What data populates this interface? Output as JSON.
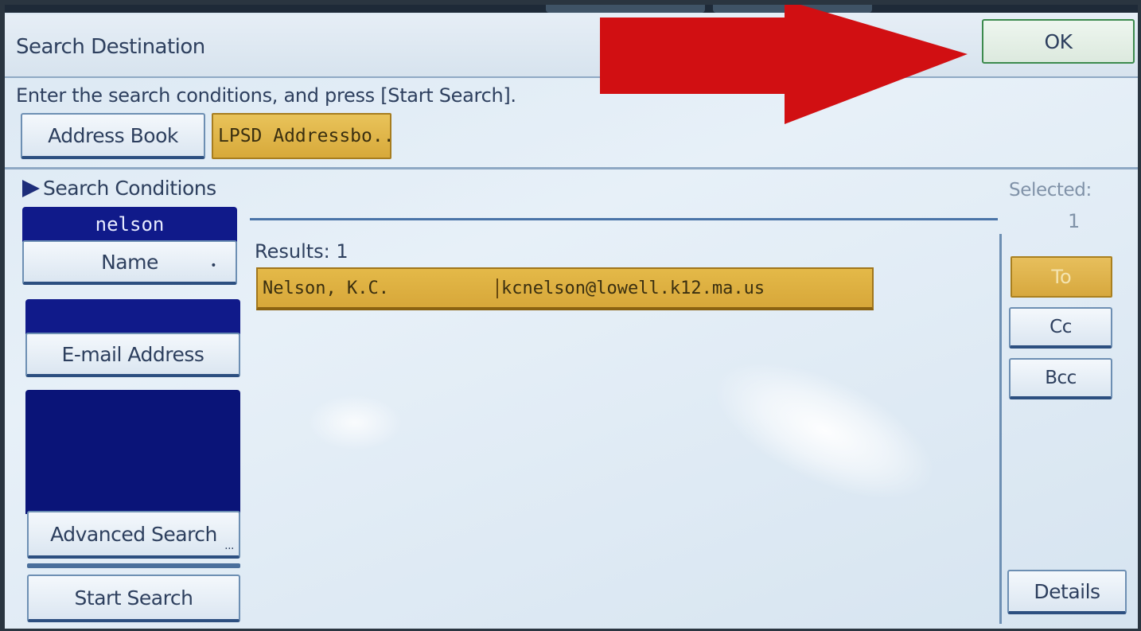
{
  "dialog": {
    "title": "Search Destination",
    "ok_label": "OK",
    "instruction": "Enter the search conditions, and press [Start Search]."
  },
  "source_tabs": [
    {
      "label": "Address Book",
      "selected": false
    },
    {
      "label": "LPSD Addressbo..",
      "selected": true
    }
  ],
  "search_conditions": {
    "header": "Search Conditions",
    "name_value": "nelson",
    "name_label": "Name",
    "email_value": "",
    "email_label": "E-mail Address",
    "advanced_label": "Advanced Search",
    "start_label": "Start Search"
  },
  "results": {
    "label": "Results: 1",
    "items": [
      {
        "name": "Nelson, K.C.",
        "email": "kcnelson@lowell.k12.ma.us",
        "selected": true
      }
    ]
  },
  "recipient": {
    "selected_label": "Selected:",
    "selected_count": "1",
    "to_label": "To",
    "cc_label": "Cc",
    "bcc_label": "Bcc",
    "details_label": "Details"
  },
  "colors": {
    "selection_gold": "#d9ab3c",
    "field_navy": "#101a8a",
    "annotation_arrow": "#d10f12",
    "ok_border": "#3c8a4d"
  }
}
